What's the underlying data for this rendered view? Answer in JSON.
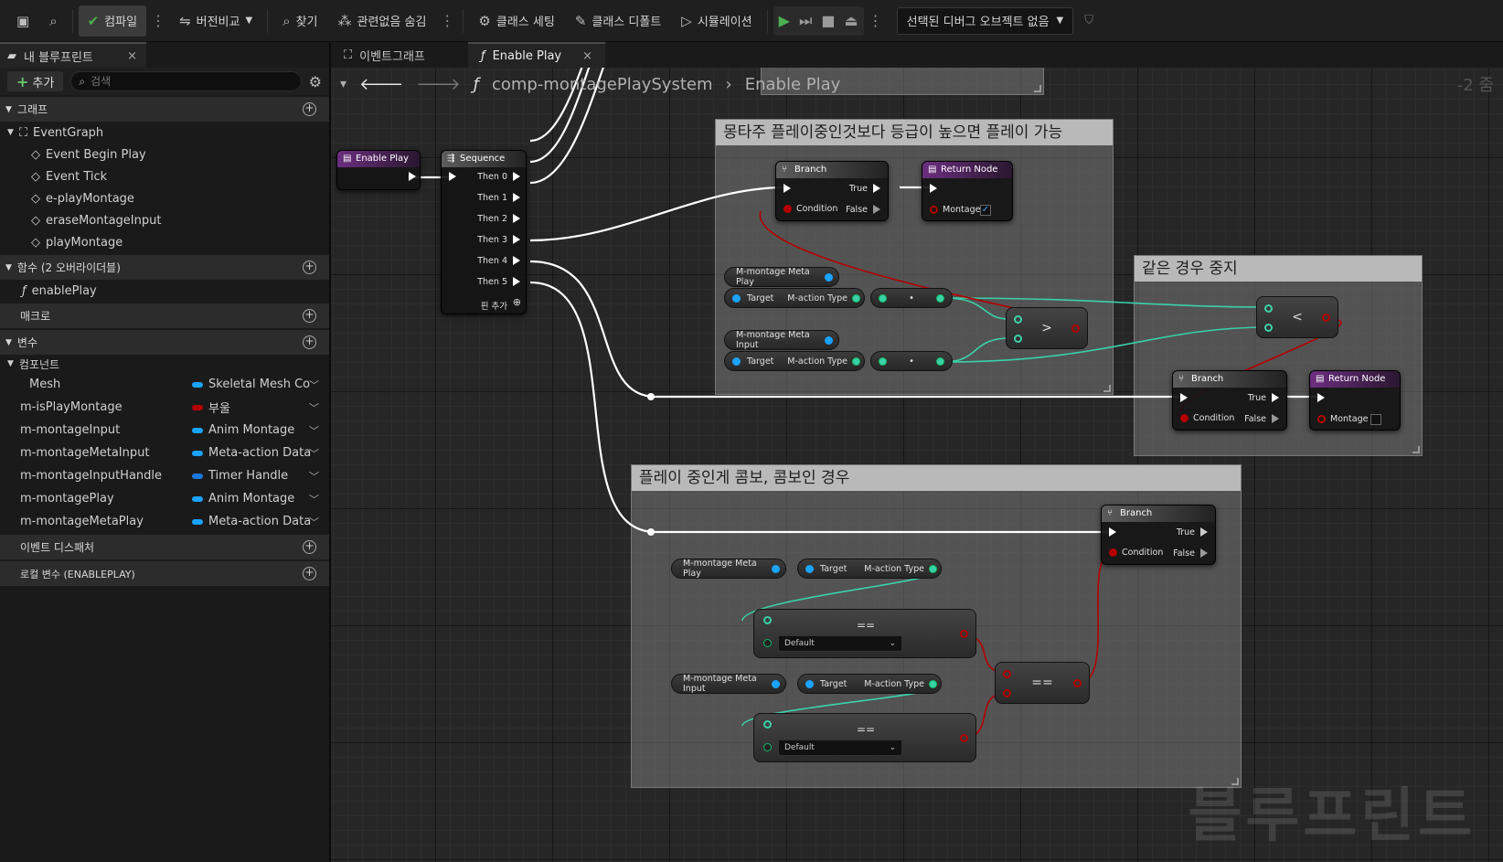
{
  "toolbar": {
    "compile": "컴파일",
    "diff": "버전비교",
    "find": "찾기",
    "hide_unrelated": "관련없음 숨김",
    "class_settings": "클래스 세팅",
    "class_defaults": "클래스 디폴트",
    "simulation": "시뮬레이션",
    "debug_object": "선택된 디버그 오브젝트 없음"
  },
  "left_panel": {
    "tab_title": "내 블루프린트",
    "add_label": "추가",
    "search_placeholder": "검색",
    "sections": {
      "graphs": "그래프",
      "functions": "함수 (2 오버라이더블)",
      "macros": "매크로",
      "variables": "변수",
      "components": "컴포넌트",
      "event_dispatchers": "이벤트 디스패처",
      "local_vars": "로컬 변수 (ENABLEPLAY)"
    },
    "event_graph": "EventGraph",
    "events": [
      "Event Begin Play",
      "Event Tick",
      "e-playMontage",
      "eraseMontageInput",
      "playMontage"
    ],
    "functions": [
      "enablePlay"
    ],
    "variables": [
      {
        "name": "Mesh",
        "type": "Skeletal Mesh Co",
        "color": "#1aa3ff"
      },
      {
        "name": "m-isPlayMontage",
        "type": "부울",
        "color": "#b40000"
      },
      {
        "name": "m-montageInput",
        "type": "Anim Montage",
        "color": "#1aa3ff"
      },
      {
        "name": "m-montageMetaInput",
        "type": "Meta-action Data",
        "color": "#1aa3ff"
      },
      {
        "name": "m-montageInputHandle",
        "type": "Timer Handle",
        "color": "#1a77dd"
      },
      {
        "name": "m-montagePlay",
        "type": "Anim Montage",
        "color": "#1aa3ff"
      },
      {
        "name": "m-montageMetaPlay",
        "type": "Meta-action Data",
        "color": "#1aa3ff"
      }
    ]
  },
  "graph_tabs": [
    "이벤트그래프",
    "Enable Play"
  ],
  "breadcrumb": {
    "path": "comp-montagePlaySystem",
    "current": "Enable Play",
    "zoom": "-2 줌"
  },
  "comments": {
    "c1": "몽타주 플레이중인것보다 등급이 높으면 플레이 가능",
    "c2": "같은 경우 중지",
    "c3": "플레이 중인게 콤보, 콤보인 경우"
  },
  "nodes": {
    "enable_play": "Enable Play",
    "sequence": "Sequence",
    "then": [
      "Then 0",
      "Then 1",
      "Then 2",
      "Then 3",
      "Then 4",
      "Then 5"
    ],
    "add_pin": "핀 추가",
    "branch": "Branch",
    "true": "True",
    "false": "False",
    "condition": "Condition",
    "return_node": "Return Node",
    "montage": "Montage",
    "meta_play": "M-montage Meta Play",
    "meta_input": "M-montage Meta Input",
    "target": "Target",
    "action_type": "M-action Type",
    "gt": ">",
    "lt": "<",
    "eq": "==",
    "default": "Default"
  },
  "watermark": "블루프린트"
}
